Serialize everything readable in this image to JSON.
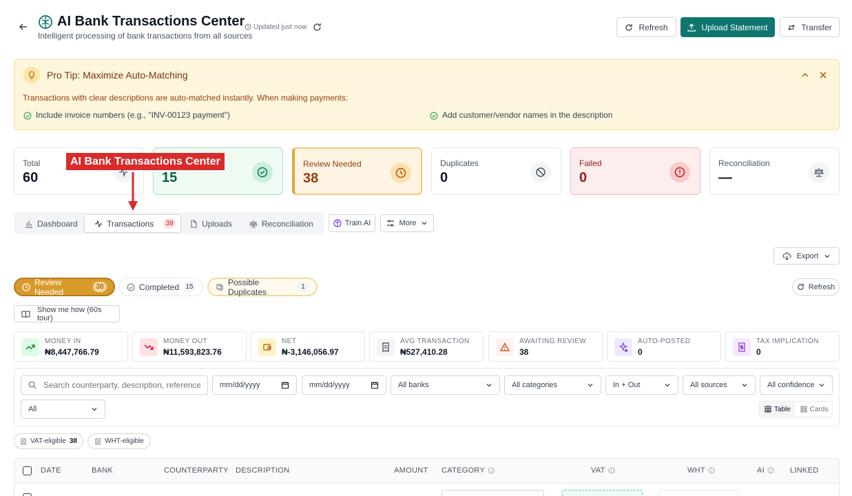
{
  "header": {
    "title": "AI Bank Transactions Center",
    "subtitle": "Intelligent processing of bank transactions from all sources",
    "updated": "Updated just now",
    "refresh_label": "Refresh",
    "upload_label": "Upload Statement",
    "transfer_label": "Transfer"
  },
  "tip": {
    "title": "Pro Tip: Maximize Auto-Matching",
    "body": "Transactions with clear descriptions are auto-matched instantly. When making payments:",
    "bullet1": "Include invoice numbers (e.g., \"INV-00123 payment\")",
    "bullet2": "Add customer/vendor names in the description"
  },
  "annotation": {
    "label": "AI Bank Transactions Center"
  },
  "cards": [
    {
      "label": "Total",
      "value": "60"
    },
    {
      "label": "",
      "value": "15"
    },
    {
      "label": "Review Needed",
      "value": "38"
    },
    {
      "label": "Duplicates",
      "value": "0"
    },
    {
      "label": "Failed",
      "value": "0"
    },
    {
      "label": "Reconciliation",
      "value": "—"
    }
  ],
  "tabs": {
    "dashboard": "Dashboard",
    "transactions": "Transactions",
    "transactions_count": "39",
    "uploads": "Uploads",
    "reconciliation": "Reconciliation",
    "train": "Train AI",
    "more": "More"
  },
  "export_label": "Export",
  "pills": {
    "review": "Review Needed",
    "review_count": "38",
    "completed": "Completed",
    "completed_count": "15",
    "duplicates": "Possible Duplicates",
    "duplicates_count": "1",
    "refresh": "Refresh"
  },
  "tour_label": "Show me how (60s tour)",
  "stats": [
    {
      "label": "Money In",
      "value": "₦8,447,766.79"
    },
    {
      "label": "Money Out",
      "value": "₦11,593,823.76"
    },
    {
      "label": "Net",
      "value": "₦-3,146,056.97"
    },
    {
      "label": "Avg Transaction",
      "value": "₦527,410.28"
    },
    {
      "label": "Awaiting Review",
      "value": "38"
    },
    {
      "label": "Auto-Posted",
      "value": "0"
    },
    {
      "label": "Tax Implication",
      "value": "0"
    }
  ],
  "filters": {
    "search_placeholder": "Search counterparty, description, reference...",
    "date_from": "mm/dd/yyyy",
    "date_to": "mm/dd/yyyy",
    "banks": "All banks",
    "categories": "All categories",
    "direction": "In + Out",
    "sources": "All sources",
    "confidence": "All confidence",
    "all": "All",
    "table": "Table",
    "cards": "Cards"
  },
  "chips": {
    "vat": "VAT-eligible",
    "vat_count": "38",
    "wht": "WHT-eligible"
  },
  "table": {
    "columns": [
      "Date",
      "Bank",
      "Counterparty",
      "Description",
      "Amount",
      "Category",
      "VAT",
      "WHT",
      "AI",
      "Linked"
    ]
  }
}
